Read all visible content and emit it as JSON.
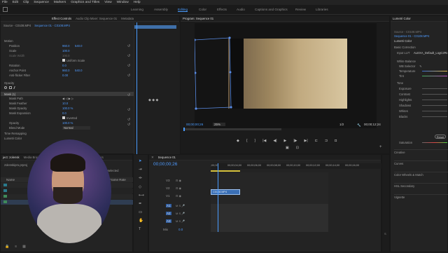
{
  "menu": [
    "File",
    "Edit",
    "Clip",
    "Sequence",
    "Markers",
    "Graphics and Titles",
    "View",
    "Window",
    "Help"
  ],
  "workspaces": [
    "Learning",
    "Assembly",
    "Editing",
    "Color",
    "Effects",
    "Audio",
    "Captions and Graphics",
    "Review",
    "Libraries"
  ],
  "workspace_active": "Editing",
  "effect_controls": {
    "tabs": [
      "Effect Controls",
      "Audio Clip Mixer: Sequence 01",
      "Metadata"
    ],
    "source": "Source - C0108.MP4",
    "seq": "Sequence 01 - C0108.MP4",
    "motion": "Motion",
    "position": {
      "label": "Position",
      "x": "960.0",
      "y": "540.0"
    },
    "scale": {
      "label": "Scale",
      "v": "100.0"
    },
    "scale_width": {
      "label": "Scale Width",
      "v": "100.0"
    },
    "uniform": "Uniform Scale",
    "rotation": {
      "label": "Rotation",
      "v": "0.0"
    },
    "anchor": {
      "label": "Anchor Point",
      "x": "960.0",
      "y": "540.0"
    },
    "flicker": {
      "label": "Anti-flicker Filter",
      "v": "0.00"
    },
    "opacity": "Opacity",
    "mask": "Mask (1)",
    "mask_path": {
      "label": "Mask Path"
    },
    "mask_feather": {
      "label": "Mask Feather",
      "v": "10.0"
    },
    "mask_opacity": {
      "label": "Mask Opacity",
      "v": "100.0 %"
    },
    "mask_expansion": {
      "label": "Mask Expansion",
      "v": "0.0"
    },
    "inverted": "Inverted",
    "opacity_v": {
      "label": "Opacity",
      "v": "100.0 %"
    },
    "blend": {
      "label": "Blend Mode",
      "v": "Normal"
    },
    "time_remap": "Time Remapping",
    "lumetri": "Lumetri Color"
  },
  "program": {
    "title": "Program: Sequence 01",
    "timecode_left": "00;00;00;26",
    "zoom": "25%",
    "fraction": "1/2",
    "timecode_right": "00;00;12;24"
  },
  "lumetri": {
    "tab": "Lumetri Color",
    "source": "Source - C0108.MP4",
    "seq": "Sequence 01 - C0108.MP4",
    "fx": "Lumetri Color",
    "basic": "Basic Correction",
    "lut_label": "Input LUT",
    "lut_v": "ALEXA_Default_LogC2Rec",
    "wb": "White Balance",
    "wb_selector": "WB Selector",
    "temperature": "Temperature",
    "tint": "Tint",
    "tone": "Tone",
    "exposure": "Exposure",
    "contrast": "Contrast",
    "highlights": "Highlights",
    "shadows": "Shadows",
    "whites": "Whites",
    "blacks": "Blacks",
    "reset": "Reset",
    "saturation": "Saturation",
    "creative": "Creative",
    "curves": "Curves",
    "color_wheels": "Color Wheels & Match",
    "hsl": "HSL Secondary",
    "vignette": "Vignette"
  },
  "project": {
    "tabs": [
      "ject: zolensk",
      "Media Browser",
      "Markers"
    ],
    "file": "zolenskipro.prproj",
    "items_selected": "1 of 4 items selected",
    "col_name": "Name",
    "col_fps": "Frame Rate"
  },
  "timeline": {
    "tab": "Sequence 01",
    "timecode": "00;00;00;26",
    "ruler": [
      ";00;00",
      "00;00;04;00",
      "00;00;06;00",
      "00;00;08;00",
      "00;00;10;00",
      "00;00;12;00",
      "00;00;14;00",
      "00;00;16;00"
    ],
    "tracks_v": [
      "V3",
      "V2",
      "V1"
    ],
    "tracks_a": [
      "A1",
      "A2",
      "A3"
    ],
    "mix": "Mix",
    "mix_v": "0.0",
    "clip": "C0108.MP4"
  },
  "colors": {
    "accent": "#4a9cff",
    "clip": "#3a6fb5",
    "clip_label": "#9ec2f0"
  }
}
